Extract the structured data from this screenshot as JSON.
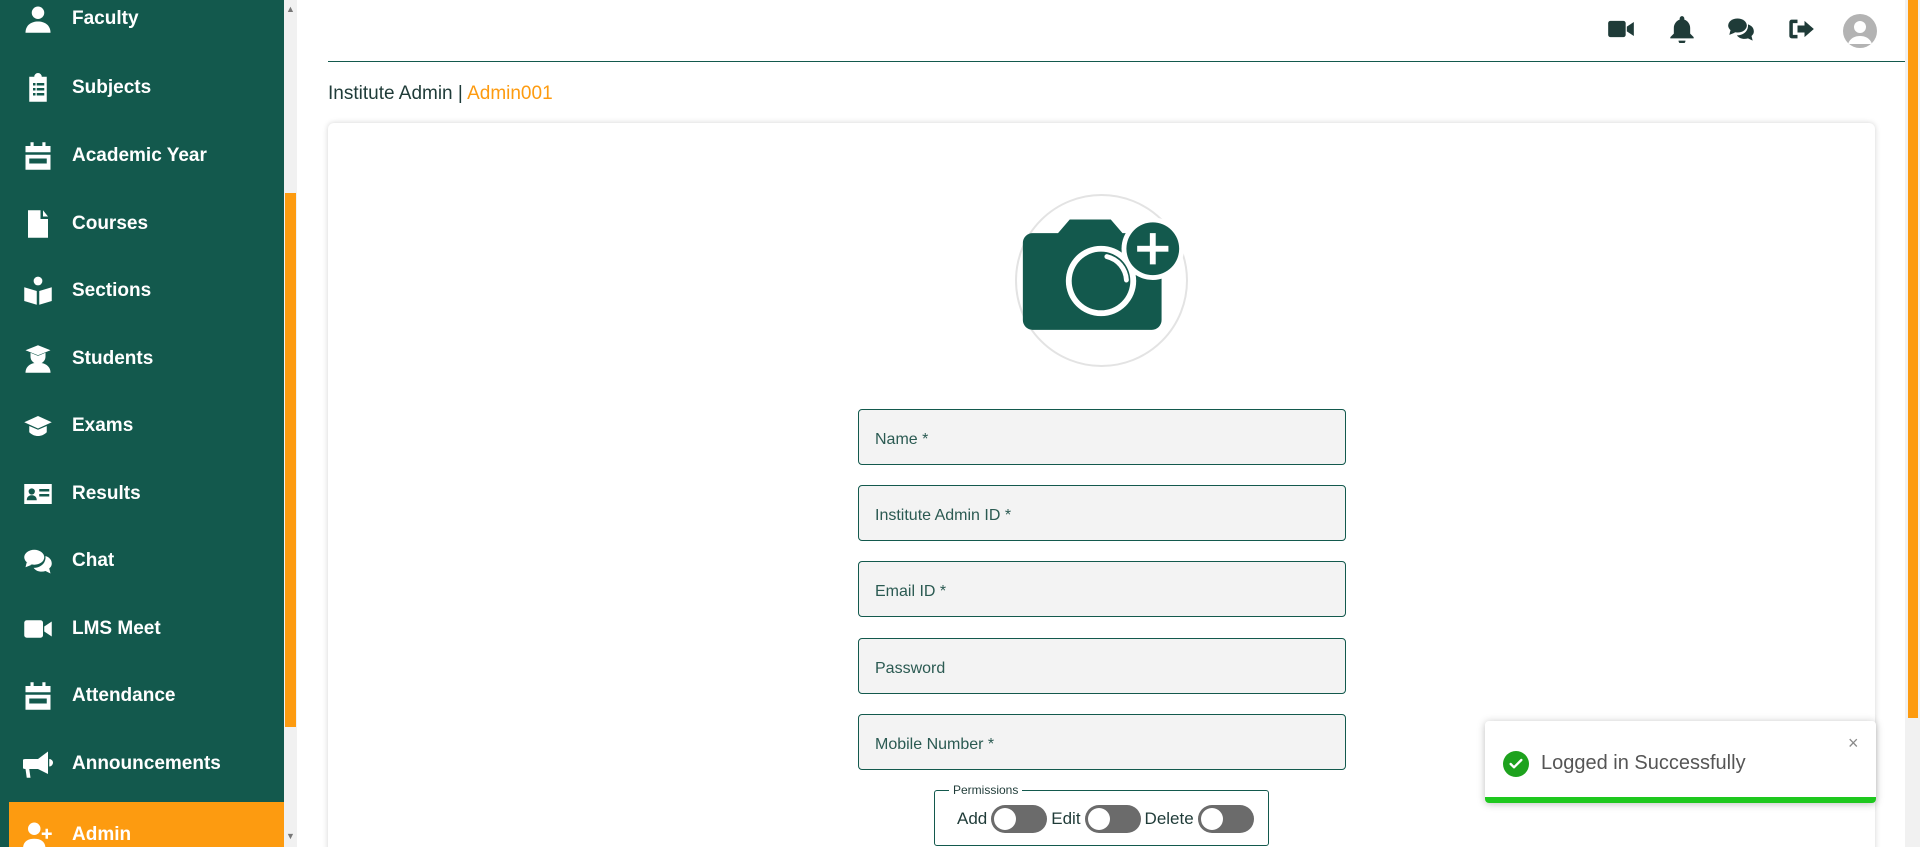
{
  "sidebar": {
    "items": [
      {
        "label": "Faculty",
        "icon": "user-icon"
      },
      {
        "label": "Subjects",
        "icon": "clipboard-list-icon"
      },
      {
        "label": "Academic Year",
        "icon": "calendar-icon"
      },
      {
        "label": "Courses",
        "icon": "file-icon"
      },
      {
        "label": "Sections",
        "icon": "book-reader-icon"
      },
      {
        "label": "Students",
        "icon": "user-graduate-icon"
      },
      {
        "label": "Exams",
        "icon": "graduation-cap-icon"
      },
      {
        "label": "Results",
        "icon": "id-card-icon"
      },
      {
        "label": "Chat",
        "icon": "comments-icon"
      },
      {
        "label": "LMS Meet",
        "icon": "video-icon"
      },
      {
        "label": "Attendance",
        "icon": "calendar-icon"
      },
      {
        "label": "Announcements",
        "icon": "bullhorn-icon"
      },
      {
        "label": "Admin",
        "icon": "user-plus-icon",
        "active": true
      }
    ]
  },
  "topbar": {
    "icons": [
      "video-icon",
      "bell-icon",
      "comments-icon",
      "sign-out-icon",
      "user-avatar-icon"
    ]
  },
  "breadcrumb": {
    "role": "Institute Admin",
    "separator": " | ",
    "user_id": "Admin001"
  },
  "form": {
    "photo_icon": "camera-plus-icon",
    "fields": [
      {
        "placeholder": "Name *",
        "value": ""
      },
      {
        "placeholder": "Institute Admin ID *",
        "value": ""
      },
      {
        "placeholder": "Email ID *",
        "value": ""
      },
      {
        "placeholder": "Password",
        "value": ""
      },
      {
        "placeholder": "Mobile Number *",
        "value": ""
      }
    ],
    "permissions": {
      "legend": "Permissions",
      "add_label": "Add",
      "edit_label": "Edit",
      "delete_label": "Delete",
      "add_on": false,
      "edit_on": false,
      "delete_on": false
    }
  },
  "toast": {
    "message": "Logged in Successfully",
    "close": "×"
  },
  "colors": {
    "primary": "#13594d",
    "accent": "#fd9b10",
    "success": "#1ec81e"
  }
}
